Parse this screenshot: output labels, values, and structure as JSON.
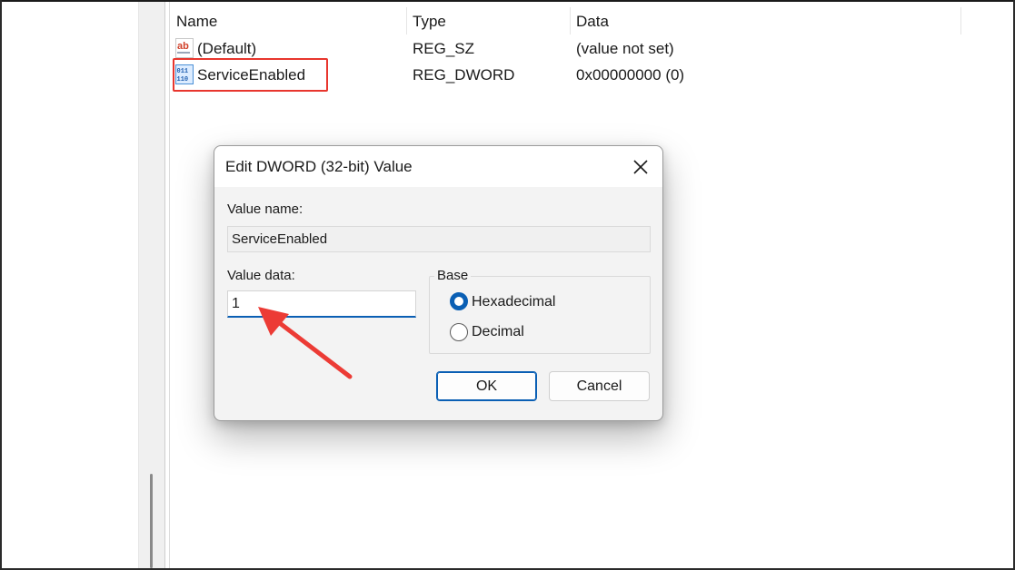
{
  "list": {
    "headers": {
      "name": "Name",
      "type": "Type",
      "data": "Data"
    },
    "rows": [
      {
        "name": "(Default)",
        "type": "REG_SZ",
        "data": "(value not set)",
        "icon": "string-value-icon",
        "icon_text": "ab"
      },
      {
        "name": "ServiceEnabled",
        "type": "REG_DWORD",
        "data": "0x00000000 (0)",
        "icon": "binary-value-icon",
        "icon_text": "011 110"
      }
    ]
  },
  "dialog": {
    "title": "Edit DWORD (32-bit) Value",
    "value_name_label": "Value name:",
    "value_name": "ServiceEnabled",
    "value_data_label": "Value data:",
    "value_data": "1",
    "base_label": "Base",
    "base_options": [
      {
        "label": "Hexadecimal",
        "selected": true
      },
      {
        "label": "Decimal",
        "selected": false
      }
    ],
    "ok_label": "OK",
    "cancel_label": "Cancel"
  },
  "colors": {
    "accent": "#0a5fb4",
    "highlight": "#e8362e",
    "arrow": "#ec3b35"
  },
  "icons": {
    "close": "close-icon",
    "arrow": "arrow-annotation-icon"
  }
}
